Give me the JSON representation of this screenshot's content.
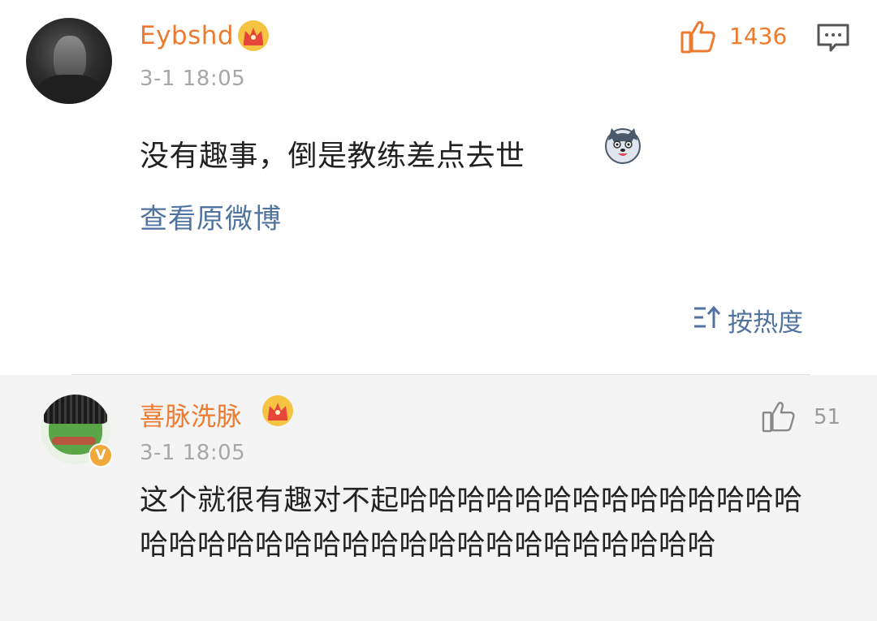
{
  "comments": [
    {
      "username": "Eybshd",
      "time": "3-1 18:05",
      "like_count": "1436",
      "text": "没有趣事，倒是教练差点去世",
      "view_original_link": "查看原微博"
    },
    {
      "username": "喜脉洗脉",
      "time": "3-1 18:05",
      "like_count": "51",
      "text": "这个就很有趣对不起哈哈哈哈哈哈哈哈哈哈哈哈哈哈哈哈哈哈哈哈哈哈哈哈哈哈哈哈哈哈哈哈哈哈"
    }
  ],
  "sort_label": "按热度",
  "icons": {
    "crown": "vip-crown-icon",
    "like": "thumbs-up-icon",
    "comment": "comment-bubble-icon",
    "sort": "sort-icon",
    "emoji": "husky-dog-emoji-icon",
    "verified": "verified-v-badge-icon"
  },
  "colors": {
    "username": "#ec7a2f",
    "link": "#5173a0",
    "like_active": "#ec7a2f",
    "timestamp": "#a7a7a7",
    "reply_bg": "#f4f4f4"
  }
}
